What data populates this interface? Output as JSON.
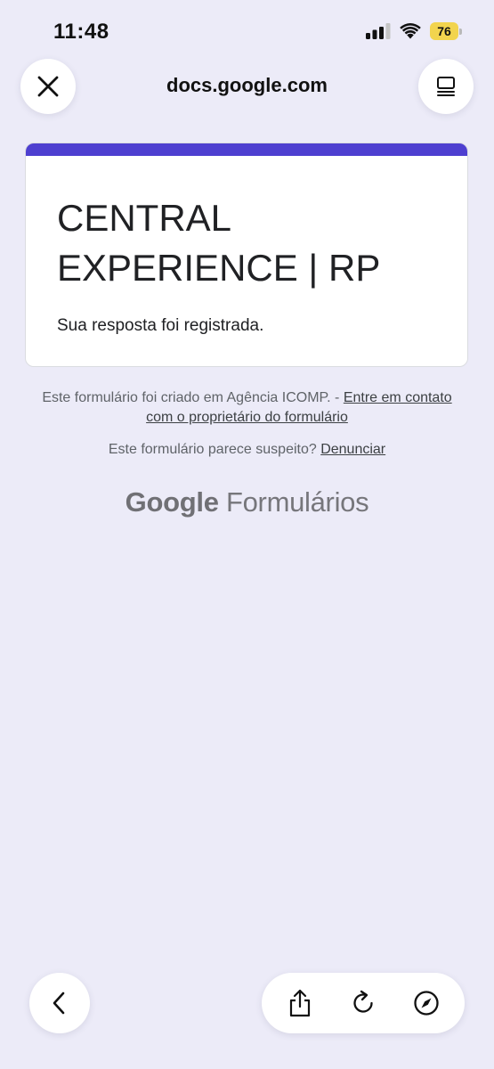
{
  "status_bar": {
    "time": "11:48",
    "battery_level": "76",
    "battery_color": "#f2d44e",
    "icons": [
      "signal-icon",
      "wifi-icon",
      "battery-icon"
    ]
  },
  "browser": {
    "url": "docs.google.com",
    "icons": {
      "close": "close-icon",
      "reader": "reader-mode-icon",
      "back": "chevron-left-icon",
      "share": "share-icon",
      "reload": "reload-icon",
      "compass": "compass-icon"
    }
  },
  "form": {
    "accent_color": "#4e3fd0",
    "title": "CENTRAL EXPERIENCE | RP",
    "message": "Sua resposta foi registrada."
  },
  "footer": {
    "created_by": "Este formulário foi criado em Agência ICOMP. - ",
    "contact_link": "Entre em contato com o proprietário do formulário",
    "suspicious": "Este formulário parece suspeito? ",
    "report_link": "Denunciar"
  },
  "logo": {
    "google": "Google",
    "product": " Formulários"
  }
}
